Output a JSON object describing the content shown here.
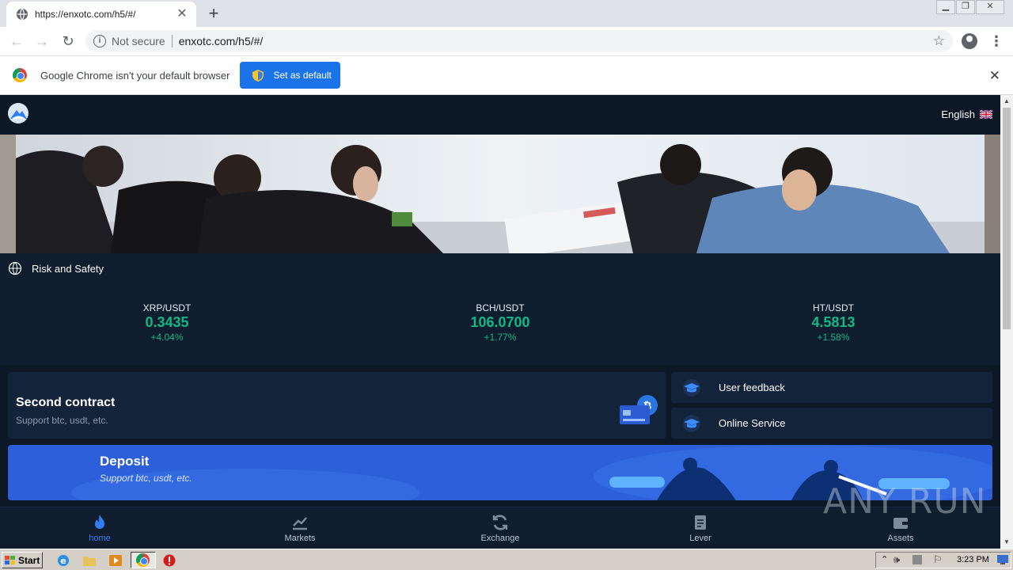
{
  "browser": {
    "tab_title": "https://enxotc.com/h5/#/",
    "security_label": "Not secure",
    "url": "enxotc.com/h5/#/",
    "infobar_message": "Google Chrome isn't your default browser",
    "set_default_label": "Set as default"
  },
  "site": {
    "language": "English",
    "risk_label": "Risk and Safety",
    "tickers": [
      {
        "pair": "XRP/USDT",
        "price": "0.3435",
        "change": "+4.04%"
      },
      {
        "pair": "BCH/USDT",
        "price": "106.0700",
        "change": "+1.77%"
      },
      {
        "pair": "HT/USDT",
        "price": "4.5813",
        "change": "+1.58%"
      }
    ],
    "contract": {
      "title": "Second contract",
      "subtitle": "Support btc, usdt, etc."
    },
    "side_links": [
      {
        "label": "User feedback",
        "icon": "graduation-cap-icon"
      },
      {
        "label": "Online Service",
        "icon": "graduation-cap-icon"
      }
    ],
    "deposit": {
      "title": "Deposit",
      "subtitle": "Support btc, usdt, etc."
    },
    "bottom_nav": [
      {
        "label": "home",
        "icon": "flame-icon",
        "active": true
      },
      {
        "label": "Markets",
        "icon": "chart-icon",
        "active": false
      },
      {
        "label": "Exchange",
        "icon": "refresh-icon",
        "active": false
      },
      {
        "label": "Lever",
        "icon": "document-icon",
        "active": false
      },
      {
        "label": "Assets",
        "icon": "wallet-icon",
        "active": false
      }
    ],
    "colors": {
      "background": "#0f1d2e",
      "positive": "#10b987",
      "accent": "#2f7ef5",
      "deposit": "#2c5fd9"
    }
  },
  "watermark": "ANY RUN",
  "taskbar": {
    "start_label": "Start",
    "clock": "3:23 PM"
  }
}
